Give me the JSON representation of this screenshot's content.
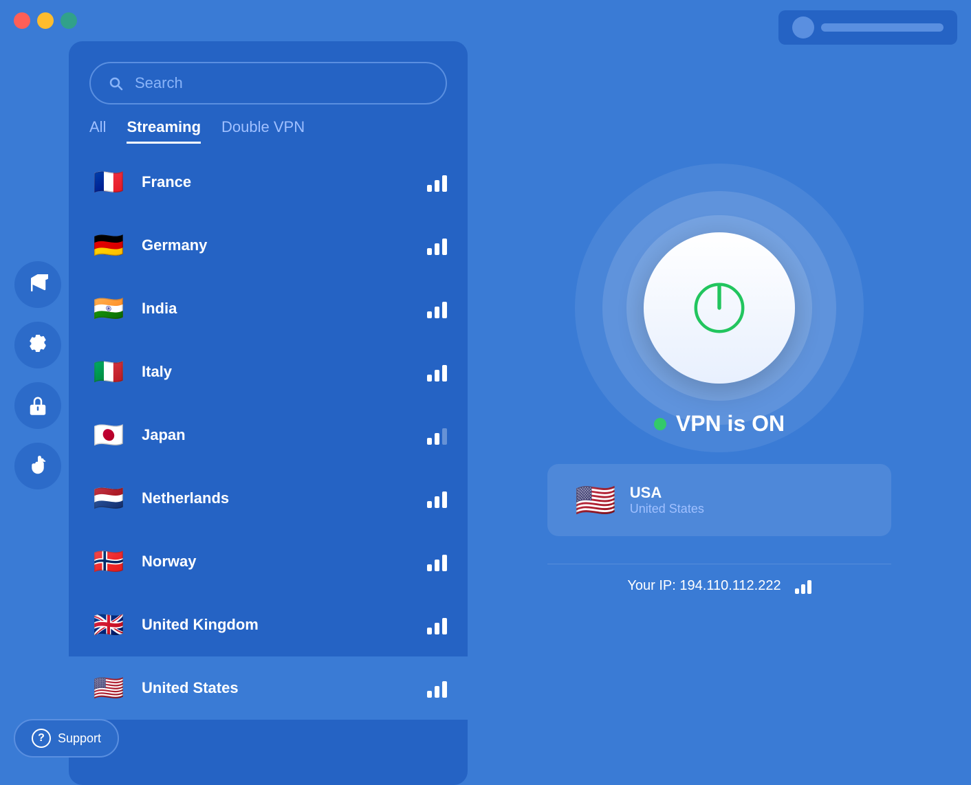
{
  "window": {
    "traffic_lights": {
      "close": "close",
      "minimize": "minimize",
      "maximize": "maximize"
    }
  },
  "top_bar": {
    "avatar_placeholder": "user-avatar",
    "text_placeholder": "user-info"
  },
  "search": {
    "placeholder": "Search"
  },
  "tabs": [
    {
      "id": "all",
      "label": "All",
      "active": false
    },
    {
      "id": "streaming",
      "label": "Streaming",
      "active": true
    },
    {
      "id": "double-vpn",
      "label": "Double VPN",
      "active": false
    }
  ],
  "countries": [
    {
      "id": "france",
      "name": "France",
      "flag": "🇫🇷",
      "signal": 3,
      "selected": false
    },
    {
      "id": "germany",
      "name": "Germany",
      "flag": "🇩🇪",
      "signal": 3,
      "selected": false
    },
    {
      "id": "india",
      "name": "India",
      "flag": "🇮🇳",
      "signal": 3,
      "selected": false
    },
    {
      "id": "italy",
      "name": "Italy",
      "flag": "🇮🇹",
      "signal": 3,
      "selected": false
    },
    {
      "id": "japan",
      "name": "Japan",
      "flag": "🇯🇵",
      "signal": 2,
      "selected": false
    },
    {
      "id": "netherlands",
      "name": "Netherlands",
      "flag": "🇳🇱",
      "signal": 3,
      "selected": false
    },
    {
      "id": "norway",
      "name": "Norway",
      "flag": "🇳🇴",
      "signal": 3,
      "selected": false
    },
    {
      "id": "united-kingdom",
      "name": "United Kingdom",
      "flag": "🇬🇧",
      "signal": 3,
      "selected": false
    },
    {
      "id": "united-states",
      "name": "United States",
      "flag": "🇺🇸",
      "signal": 3,
      "selected": true
    }
  ],
  "sidebar": {
    "items": [
      {
        "id": "flag",
        "icon": "flag-icon"
      },
      {
        "id": "settings",
        "icon": "settings-icon"
      },
      {
        "id": "privacy",
        "icon": "lock-icon"
      },
      {
        "id": "block",
        "icon": "hand-icon"
      }
    ]
  },
  "vpn_status": {
    "status": "VPN is ON",
    "dot_color": "#22c55e"
  },
  "location": {
    "flag": "🇺🇸",
    "country_code": "USA",
    "country_name": "United States"
  },
  "ip_info": {
    "label": "Your IP:",
    "address": "194.110.112.222"
  },
  "support": {
    "label": "Support"
  }
}
